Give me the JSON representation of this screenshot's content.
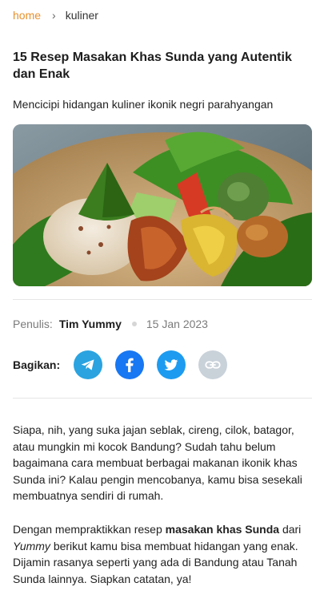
{
  "breadcrumb": {
    "home": "home",
    "separator": "›",
    "current": "kuliner"
  },
  "article": {
    "title": "15 Resep Masakan Khas Sunda yang Autentik dan Enak",
    "subtitle": "Mencicipi hidangan kuliner ikonik negri parahyangan",
    "author_label": "Penulis:",
    "author_name": "Tim Yummy",
    "date": "15 Jan 2023"
  },
  "share": {
    "label": "Bagikan:",
    "buttons": [
      {
        "icon": "telegram-icon",
        "color": "#2aa3e0"
      },
      {
        "icon": "facebook-icon",
        "color": "#1877f2"
      },
      {
        "icon": "twitter-icon",
        "color": "#1d9bf0"
      },
      {
        "icon": "link-icon",
        "color": "#c9d1d9"
      }
    ]
  },
  "content": {
    "paragraph1": "Siapa, nih, yang suka jajan seblak, cireng, cilok, batagor, atau mungkin mi kocok Bandung? Sudah tahu belum bagaimana cara membuat berbagai makanan ikonik khas Sunda ini? Kalau pengin mencobanya, kamu bisa sesekali membuatnya sendiri di rumah.",
    "paragraph2": {
      "part1": "Dengan mempraktikkan resep ",
      "bold": "masakan khas Sunda",
      "part2": " dari ",
      "italic": "Yummy",
      "part3": " berikut kamu bisa membuat hidangan yang enak. Dijamin rasanya seperti yang ada di Bandung atau Tanah Sunda lainnya. Siapkan catatan, ya!"
    }
  },
  "colors": {
    "accent": "#e8912d"
  }
}
